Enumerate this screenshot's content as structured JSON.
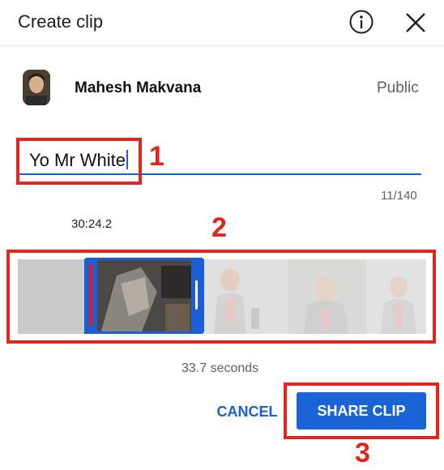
{
  "header": {
    "title": "Create clip",
    "info_icon": "info-icon",
    "close_icon": "close-icon"
  },
  "channel": {
    "name": "Mahesh Makvana",
    "visibility": "Public"
  },
  "clip_title": {
    "value": "Yo Mr White",
    "counter": "11/140"
  },
  "timeline": {
    "start_time": "30:24.2",
    "duration": "33.7 seconds"
  },
  "actions": {
    "cancel_label": "CANCEL",
    "share_label": "SHARE CLIP"
  },
  "annotations": {
    "one": "1",
    "two": "2",
    "three": "3"
  },
  "colors": {
    "accent": "#1a5fd6",
    "annotation_red": "#e3261b"
  }
}
